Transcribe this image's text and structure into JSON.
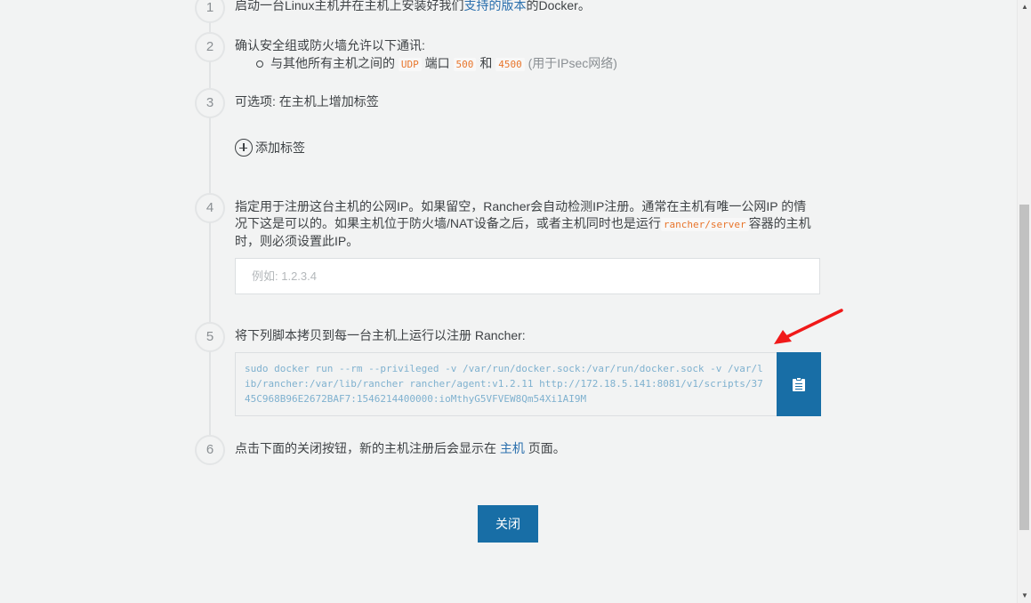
{
  "steps": [
    {
      "number": "1",
      "text_pre": "启动一台Linux主机并在主机上安装好我们",
      "link": "支持的版本",
      "text_post": "的Docker。"
    },
    {
      "number": "2",
      "text": "确认安全组或防火墙允许以下通讯:",
      "bullet": {
        "pre": "与其他所有主机之间的",
        "protocol": "UDP",
        "mid": "端口",
        "port1": "500",
        "and": "和",
        "port2": "4500",
        "note": "(用于IPsec网络)"
      }
    },
    {
      "number": "3",
      "text": "可选项: 在主机上增加标签",
      "add_label": "添加标签"
    },
    {
      "number": "4",
      "text_pre": "指定用于注册这台主机的公网IP。如果留空，Rancher会自动检测IP注册。通常在主机有唯一公网IP 的情况下这是可以的。如果主机位于防火墙/NAT设备之后，或者主机同时也是运行",
      "code": "rancher/server",
      "text_post": "容器的主机时，则必须设置此IP。",
      "input_placeholder": "例如: 1.2.3.4"
    },
    {
      "number": "5",
      "text": "将下列脚本拷贝到每一台主机上运行以注册 Rancher:",
      "command": "sudo docker run --rm --privileged -v /var/run/docker.sock:/var/run/docker.sock -v /var/lib/rancher:/var/lib/rancher rancher/agent:v1.2.11 http://172.18.5.141:8081/v1/scripts/3745C968B96E2672BAF7:1546214400000:ioMthyG5VFVEW8Qm54Xi1AI9M"
    },
    {
      "number": "6",
      "text_pre": "点击下面的关闭按钮，新的主机注册后会显示在",
      "link": "主机",
      "text_post": "页面。"
    }
  ],
  "close_button": "关闭",
  "icons": {
    "add": "plus-circle-icon",
    "copy": "clipboard-icon",
    "annotation": "red-arrow"
  },
  "colors": {
    "primary": "#186ea6",
    "link": "#2a6fad",
    "inline_code": "#e8752b",
    "annotation_arrow": "#f01919"
  }
}
